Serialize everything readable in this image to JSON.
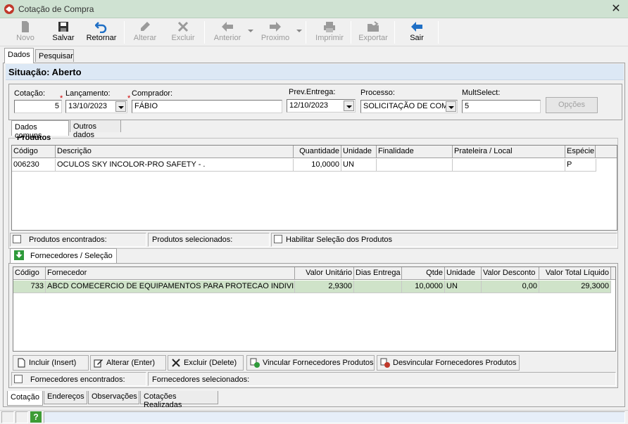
{
  "window": {
    "title": "Cotação de Compra",
    "close_glyph": "✕"
  },
  "toolbar": {
    "novo": "Novo",
    "salvar": "Salvar",
    "retornar": "Retornar",
    "alterar": "Alterar",
    "excluir": "Excluir",
    "anterior": "Anterior",
    "proximo": "Proximo",
    "imprimir": "Imprimir",
    "exportar": "Exportar",
    "sair": "Sair"
  },
  "top_tabs": [
    "Dados",
    "Pesquisar"
  ],
  "situacao": "Situação: Aberto",
  "form": {
    "cotacao_label": "Cotação:",
    "cotacao_value": "5",
    "lancamento_label": "Lançamento:",
    "lancamento_value": "13/10/2023",
    "comprador_label": "Comprador:",
    "comprador_value": "FÁBIO",
    "prev_entrega_label": "Prev.Entrega:",
    "prev_entrega_value": "12/10/2023",
    "processo_label": "Processo:",
    "processo_value": "SOLICITAÇÃO DE COM",
    "multselect_label": "MultSelect:",
    "multselect_value": "5",
    "opcoes_button": "Opções",
    "required_mark": "*"
  },
  "sub_tabs": [
    "Dados comuns",
    "Outros dados"
  ],
  "produtos": {
    "group_title": "Produtos",
    "columns": [
      "Código",
      "Descrição",
      "Quantidade",
      "Unidade",
      "Finalidade",
      "Prateleira / Local",
      "Espécie"
    ],
    "rows": [
      [
        "006230",
        "OCULOS SKY INCOLOR-PRO SAFETY - .",
        "10,0000",
        "UN",
        "",
        "",
        "P"
      ]
    ],
    "encontrados": "Produtos encontrados:",
    "selecionados": "Produtos selecionados:",
    "habilitar": "Habilitar Seleção dos Produtos"
  },
  "fornecedores": {
    "tab_label": "Fornecedores / Seleção",
    "columns": [
      "Código",
      "Fornecedor",
      "Valor Unitário",
      "Dias Entrega",
      "Qtde",
      "Unidade",
      "Valor Desconto",
      "Valor Total Líquido"
    ],
    "rows": [
      [
        "733",
        "ABCD COMECERCIO DE EQUIPAMENTOS PARA PROTECAO INDIVIDI",
        "2,9300",
        "",
        "10,0000",
        "UN",
        "0,00",
        "29,3000"
      ]
    ],
    "buttons": {
      "incluir": "Incluir (Insert)",
      "alterar": "Alterar (Enter)",
      "excluir": "Excluir (Delete)",
      "vincular": "Vincular Fornecedores Produtos",
      "desvincular": "Desvincular Fornecedores Produtos"
    },
    "encontrados": "Fornecedores encontrados:",
    "selecionados": "Fornecedores selecionados:"
  },
  "bottom_tabs": [
    "Cotação",
    "Endereços",
    "Observações",
    "Cotações Realizadas"
  ],
  "statusbar": {
    "help_glyph": "?"
  },
  "colors": {
    "selected_row": "#cfe3c9",
    "title_bar": "#cfe2d2",
    "situacao_bg": "#dce8f5"
  }
}
